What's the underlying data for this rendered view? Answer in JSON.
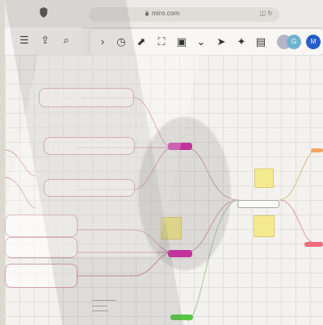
{
  "browser": {
    "url": "miro.com"
  },
  "toolbar": {
    "left_icons": [
      "menu-icon",
      "upload-icon",
      "search-icon"
    ],
    "main_icons": [
      "chevron-right-icon",
      "timer-icon",
      "export-icon",
      "fullscreen-icon",
      "page-icon",
      "chevron-down-icon",
      "cursor-icon",
      "celebration-icon",
      "comment-icon"
    ],
    "avatars": [
      "avatar-1",
      "G",
      "M"
    ]
  },
  "colors": {
    "magenta": "#d526a6",
    "green": "#58c844",
    "yellow": "#f3e27f",
    "pink": "#ef6b79",
    "orange": "#f2a55e",
    "line_pink": "#d789a5",
    "line_green": "#9ec38f"
  }
}
